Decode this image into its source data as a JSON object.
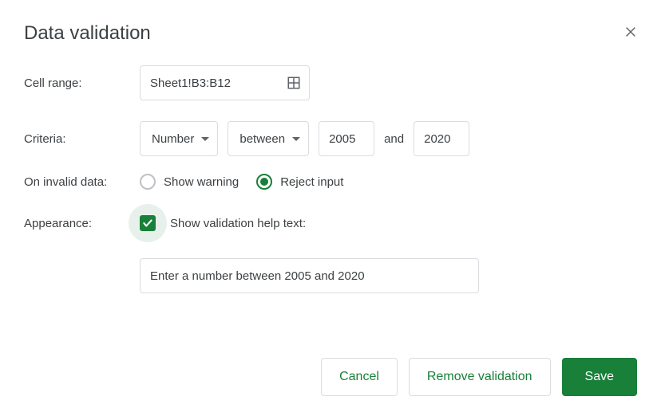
{
  "dialog": {
    "title": "Data validation"
  },
  "labels": {
    "cell_range": "Cell range:",
    "criteria": "Criteria:",
    "on_invalid_data": "On invalid data:",
    "appearance": "Appearance:"
  },
  "cell_range": {
    "value": "Sheet1!B3:B12"
  },
  "criteria": {
    "type": "Number",
    "operator": "between",
    "min": "2005",
    "and_text": "and",
    "max": "2020"
  },
  "on_invalid": {
    "options": {
      "show_warning": "Show warning",
      "reject_input": "Reject input"
    },
    "selected": "reject_input"
  },
  "appearance": {
    "checkbox_label": "Show validation help text:",
    "checked": true,
    "help_text": "Enter a number between 2005 and 2020"
  },
  "buttons": {
    "cancel": "Cancel",
    "remove": "Remove validation",
    "save": "Save"
  }
}
